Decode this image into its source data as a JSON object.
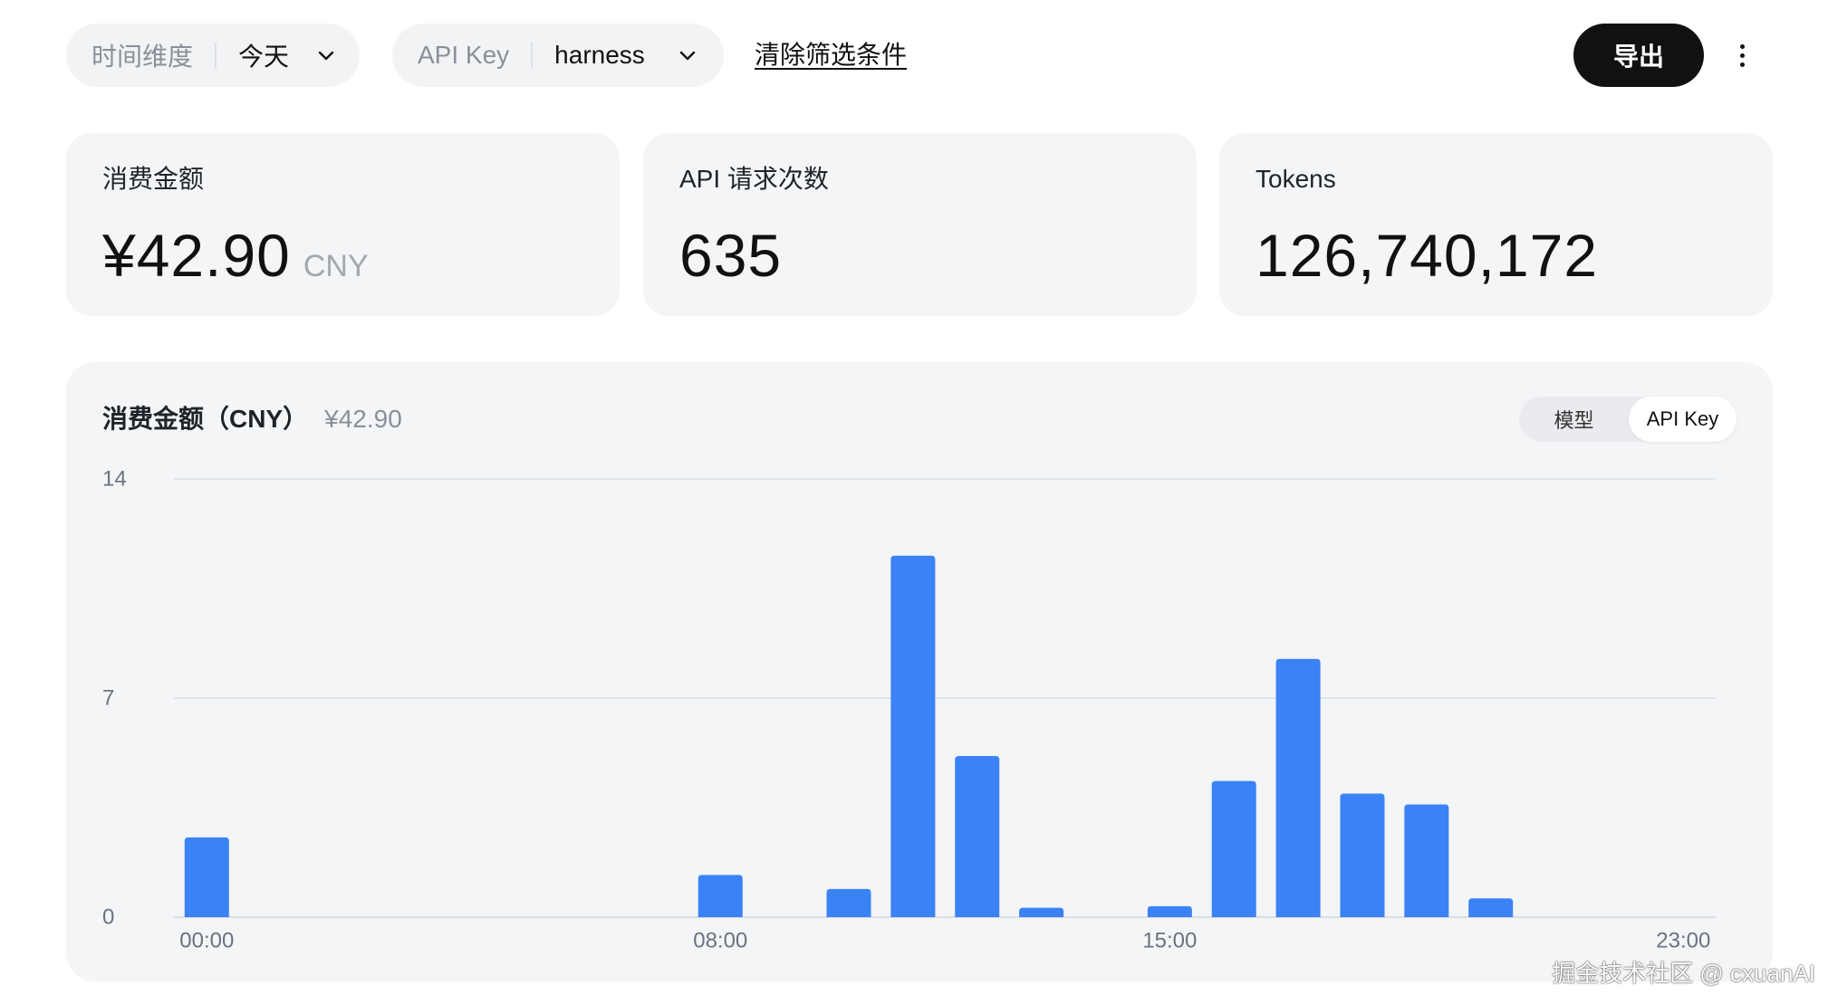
{
  "filters": {
    "time": {
      "label": "时间维度",
      "value": "今天"
    },
    "api_key": {
      "label": "API Key",
      "value": "harness"
    },
    "clear_label": "清除筛选条件"
  },
  "toolbar": {
    "export_label": "导出",
    "more_icon": "more-vertical-icon"
  },
  "stats": [
    {
      "label": "消费金额",
      "value": "¥42.90",
      "unit": "CNY"
    },
    {
      "label": "API 请求次数",
      "value": "635"
    },
    {
      "label": "Tokens",
      "value": "126,740,172"
    }
  ],
  "chart_panel": {
    "total": "¥42.90",
    "toggle": {
      "options": [
        "模型",
        "API Key"
      ],
      "selected_index": 1
    }
  },
  "chart_data": {
    "type": "bar",
    "title": "消费金额（CNY）",
    "xlabel": "",
    "ylabel": "",
    "x": [
      0,
      1,
      2,
      3,
      4,
      5,
      6,
      7,
      8,
      9,
      10,
      11,
      12,
      13,
      14,
      15,
      16,
      17,
      18,
      19,
      20,
      21,
      22,
      23
    ],
    "values": [
      2.55,
      0,
      0,
      0,
      0,
      0,
      0,
      0,
      1.35,
      0,
      0.9,
      11.55,
      5.15,
      0.3,
      0,
      0.35,
      4.35,
      8.25,
      3.95,
      3.6,
      0.6,
      0,
      0,
      0
    ],
    "xticks": [
      {
        "x": 0,
        "label": "00:00"
      },
      {
        "x": 8,
        "label": "08:00"
      },
      {
        "x": 15,
        "label": "15:00"
      },
      {
        "x": 23,
        "label": "23:00"
      }
    ],
    "yticks": [
      0,
      7,
      14
    ],
    "ylim": [
      0,
      14
    ],
    "grid": true
  },
  "colors": {
    "bar": "#3b82f6",
    "button_dark": "#111111",
    "panel_bg": "#f4f5f7"
  },
  "watermark": "掘金技术社区 @ cxuanAI"
}
